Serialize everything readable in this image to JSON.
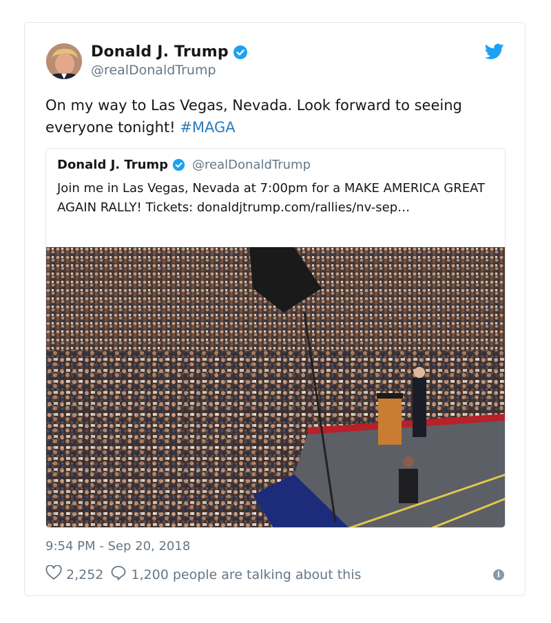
{
  "tweet": {
    "author_name": "Donald J. Trump",
    "author_handle": "@realDonaldTrump",
    "text_main": "On my way to Las Vegas, Nevada. Look forward to seeing everyone tonight! ",
    "hashtag": "#MAGA",
    "timestamp": "9:54 PM - Sep 20, 2018",
    "likes": "2,252",
    "talking": "1,200 people are talking about this"
  },
  "quoted": {
    "author_name": "Donald J. Trump",
    "author_handle": "@realDonaldTrump",
    "text": "Join me in Las Vegas, Nevada at 7:00pm for a MAKE AMERICA GREAT AGAIN RALLY! Tickets: donaldjtrump.com/rallies/nv-sep…"
  },
  "icons": {
    "verified": "verified-badge-icon",
    "bird": "twitter-bird-icon",
    "heart": "heart-icon",
    "reply": "speech-bubble-icon",
    "info": "info-icon"
  },
  "colors": {
    "link": "#2b7bb9",
    "verified": "#1da1f2",
    "muted": "#657786",
    "border": "#e1e8ed"
  }
}
